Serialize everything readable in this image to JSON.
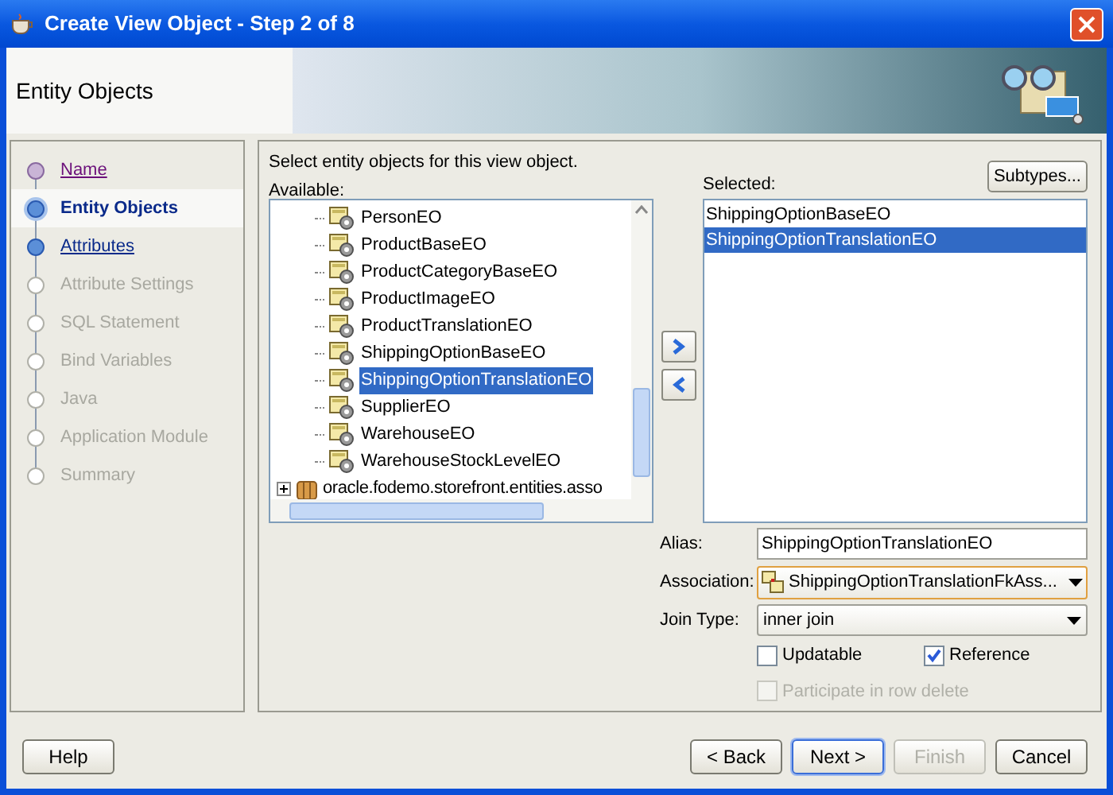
{
  "window": {
    "title": "Create View Object - Step 2 of 8"
  },
  "header": {
    "title": "Entity Objects"
  },
  "steps": [
    {
      "label": "Name",
      "selected": false,
      "visited": true,
      "disabled": false
    },
    {
      "label": "Entity Objects",
      "selected": true,
      "visited": false,
      "disabled": false
    },
    {
      "label": "Attributes",
      "selected": false,
      "visited": false,
      "disabled": false
    },
    {
      "label": "Attribute Settings",
      "selected": false,
      "visited": false,
      "disabled": true
    },
    {
      "label": "SQL Statement",
      "selected": false,
      "visited": false,
      "disabled": true
    },
    {
      "label": "Bind Variables",
      "selected": false,
      "visited": false,
      "disabled": true
    },
    {
      "label": "Java",
      "selected": false,
      "visited": false,
      "disabled": true
    },
    {
      "label": "Application Module",
      "selected": false,
      "visited": false,
      "disabled": true
    },
    {
      "label": "Summary",
      "selected": false,
      "visited": false,
      "disabled": true
    }
  ],
  "instructions": "Select entity objects for this view object.",
  "available": {
    "label": "Available:",
    "items": [
      {
        "label": "PersonEO",
        "selected": false
      },
      {
        "label": "ProductBaseEO",
        "selected": false
      },
      {
        "label": "ProductCategoryBaseEO",
        "selected": false
      },
      {
        "label": "ProductImageEO",
        "selected": false
      },
      {
        "label": "ProductTranslationEO",
        "selected": false
      },
      {
        "label": "ShippingOptionBaseEO",
        "selected": false
      },
      {
        "label": "ShippingOptionTranslationEO",
        "selected": true
      },
      {
        "label": "SupplierEO",
        "selected": false
      },
      {
        "label": "WarehouseEO",
        "selected": false
      },
      {
        "label": "WarehouseStockLevelEO",
        "selected": false
      }
    ],
    "groups": [
      {
        "label": "oracle.fodemo.storefront.entities.asso",
        "expanded": false
      }
    ]
  },
  "subtypes_button": "Subtypes...",
  "selected_list": {
    "label": "Selected:",
    "items": [
      {
        "label": "ShippingOptionBaseEO",
        "selected": false
      },
      {
        "label": "ShippingOptionTranslationEO",
        "selected": true
      }
    ]
  },
  "alias": {
    "label": "Alias:",
    "value": "ShippingOptionTranslationEO"
  },
  "association": {
    "label": "Association:",
    "value": "ShippingOptionTranslationFkAss..."
  },
  "join_type": {
    "label": "Join Type:",
    "value": "inner join"
  },
  "options": [
    {
      "label": "Updatable",
      "checked": false,
      "disabled": false
    },
    {
      "label": "Reference",
      "checked": true,
      "disabled": false
    },
    {
      "label": "Participate in row delete",
      "checked": false,
      "disabled": true
    }
  ],
  "help_button": "Help",
  "buttons": [
    {
      "label": "< Back",
      "disabled": false,
      "default": false
    },
    {
      "label": "Next >",
      "disabled": false,
      "default": true
    },
    {
      "label": "Finish",
      "disabled": true,
      "default": false
    },
    {
      "label": "Cancel",
      "disabled": false,
      "default": false
    }
  ]
}
